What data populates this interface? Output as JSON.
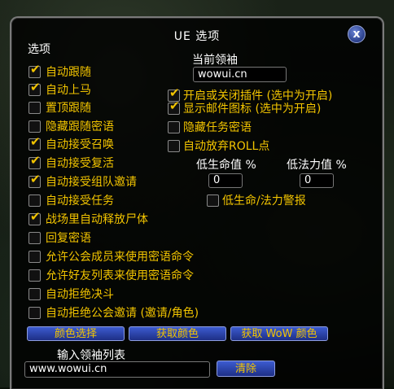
{
  "window": {
    "title": "UE 选项",
    "close_label": "x"
  },
  "left_section_label": "选项",
  "left_options": [
    {
      "label": "自动跟随",
      "checked": true
    },
    {
      "label": "自动上马",
      "checked": true
    },
    {
      "label": "置顶跟随",
      "checked": false
    },
    {
      "label": "隐藏跟随密语",
      "checked": false
    },
    {
      "label": "自动接受召唤",
      "checked": true
    },
    {
      "label": "自动接受复活",
      "checked": true
    },
    {
      "label": "自动接受组队邀请",
      "checked": true
    },
    {
      "label": "自动接受任务",
      "checked": false
    },
    {
      "label": "战场里自动释放尸体",
      "checked": true
    },
    {
      "label": "回复密语",
      "checked": false
    },
    {
      "label": "允许公会成员来使用密语命令",
      "checked": false
    },
    {
      "label": "允许好友列表来使用密语命令",
      "checked": false
    },
    {
      "label": "自动拒绝决斗",
      "checked": false
    },
    {
      "label": "自动拒绝公会邀请 (邀请/角色)",
      "checked": false
    }
  ],
  "leader": {
    "label": "当前领袖",
    "value": "wowui.cn"
  },
  "right_options": [
    {
      "label": "开启或关闭插件 (选中为开启)",
      "checked": true
    },
    {
      "label": "显示邮件图标 (选中为开启)",
      "checked": true
    },
    {
      "label": "隐藏任务密语",
      "checked": false
    },
    {
      "label": "自动放弃ROLL点",
      "checked": false
    }
  ],
  "low_health": {
    "label": "低生命值 %",
    "value": "0"
  },
  "low_mana": {
    "label": "低法力值 %",
    "value": "0"
  },
  "low_warning": {
    "label": "低生命/法力警报",
    "checked": false
  },
  "buttons": {
    "color_pick": "颜色选择",
    "get_color": "获取颜色",
    "get_wow_color": "获取 WoW 颜色",
    "clear": "清除"
  },
  "leader_list": {
    "label": "输入领袖列表",
    "value": "www.wowui.cn"
  }
}
